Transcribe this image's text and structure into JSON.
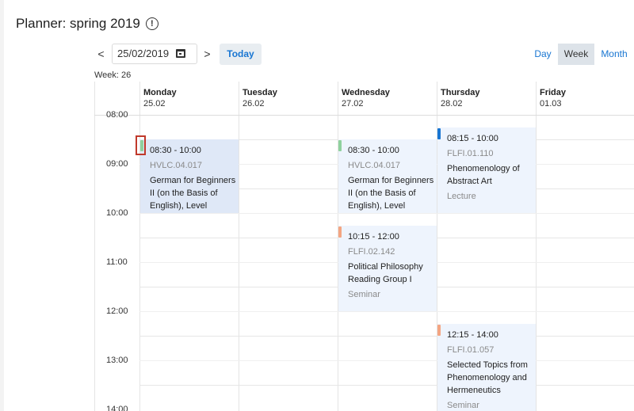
{
  "header": {
    "title": "Planner: spring 2019",
    "info_icon": "info-icon"
  },
  "toolbar": {
    "prev_label": "<",
    "next_label": ">",
    "date_value": "25/02/2019",
    "today_label": "Today",
    "views": [
      "Day",
      "Week",
      "Month"
    ],
    "active_view": "Week"
  },
  "week_label": "Week: 26",
  "days": [
    {
      "name": "Monday",
      "date": "25.02"
    },
    {
      "name": "Tuesday",
      "date": "26.02"
    },
    {
      "name": "Wednesday",
      "date": "27.02"
    },
    {
      "name": "Thursday",
      "date": "28.02"
    },
    {
      "name": "Friday",
      "date": "01.03"
    }
  ],
  "times": [
    "08:00",
    "09:00",
    "10:00",
    "11:00",
    "12:00",
    "13:00",
    "14:00"
  ],
  "events": [
    {
      "day": "Monday",
      "time": "08:30 - 10:00",
      "room": "HVLC.04.017",
      "title": "German for Beginners II (on the Basis of English), Level",
      "type": "",
      "color": "#8fd19e",
      "selected": true
    },
    {
      "day": "Wednesday",
      "time": "08:30 - 10:00",
      "room": "HVLC.04.017",
      "title": "German for Beginners II (on the Basis of English), Level",
      "type": "",
      "color": "#8fd19e",
      "selected": false
    },
    {
      "day": "Thursday",
      "time": "08:15 - 10:00",
      "room": "FLFI.01.110",
      "title": "Phenomenology of Abstract Art",
      "type": "Lecture",
      "color": "#1976d2",
      "selected": false
    },
    {
      "day": "Wednesday",
      "time": "10:15 - 12:00",
      "room": "FLFI.02.142",
      "title": "Political Philosophy Reading Group I",
      "type": "Seminar",
      "color": "#f4a582",
      "selected": false
    },
    {
      "day": "Thursday",
      "time": "12:15 - 14:00",
      "room": "FLFI.01.057",
      "title": "Selected Topics from Phenomenology and Hermeneutics",
      "type": "Seminar",
      "color": "#f4a582",
      "selected": false
    }
  ]
}
